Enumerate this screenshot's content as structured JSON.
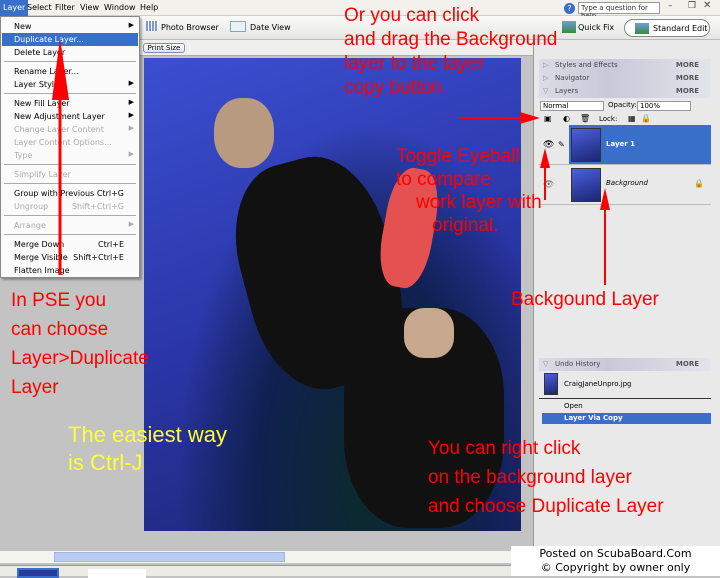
{
  "menubar": {
    "items": [
      "Layer",
      "Select",
      "Filter",
      "View",
      "Window",
      "Help"
    ],
    "help_placeholder": "Type a question for help"
  },
  "toolbar": {
    "photo_browser": "Photo Browser",
    "date_view": "Date View",
    "quick_fix": "Quick Fix",
    "standard_edit": "Standard Edit"
  },
  "options": {
    "print_size": "Print Size"
  },
  "layer_menu": [
    {
      "label": "New",
      "submenu": true
    },
    {
      "label": "Duplicate Layer...",
      "selected": true
    },
    {
      "label": "Delete Layer"
    },
    {
      "label": "Rename Layer..."
    },
    {
      "label": "Layer Style",
      "submenu": true
    },
    {
      "label": "New Fill Layer",
      "submenu": true
    },
    {
      "label": "New Adjustment Layer",
      "submenu": true
    },
    {
      "label": "Change Layer Content",
      "disabled": true,
      "submenu": true
    },
    {
      "label": "Layer Content Options...",
      "disabled": true
    },
    {
      "label": "Type",
      "disabled": true,
      "submenu": true
    },
    {
      "label": "Simplify Layer",
      "disabled": true
    },
    {
      "label": "Group with Previous",
      "shortcut": "Ctrl+G"
    },
    {
      "label": "Ungroup",
      "shortcut": "Shift+Ctrl+G",
      "disabled": true
    },
    {
      "label": "Arrange",
      "disabled": true,
      "submenu": true
    },
    {
      "label": "Merge Down",
      "shortcut": "Ctrl+E"
    },
    {
      "label": "Merge Visible",
      "shortcut": "Shift+Ctrl+E"
    },
    {
      "label": "Flatten Image"
    }
  ],
  "panels": {
    "styles": "Styles and Effects",
    "navigator": "Navigator",
    "layers": "Layers",
    "more": "MORE",
    "blend_mode": "Normal",
    "opacity_label": "Opacity:",
    "opacity": "100%",
    "lock_label": "Lock:",
    "layer1": "Layer 1",
    "background": "Background",
    "undo": "Undo History",
    "file": "CraigJaneUnpro.jpg",
    "open": "Open",
    "via_copy": "Layer Via Copy"
  },
  "annotations": {
    "drag": [
      "Or you can click",
      "and drag the Background",
      "layer to the layer",
      "copy button"
    ],
    "eyeball": [
      "Toggle Eyeball",
      "to compare",
      "work layer with",
      "original."
    ],
    "bg_layer": "Backgound Layer",
    "pse": [
      "In PSE you",
      "can choose",
      "Layer>Duplicate",
      "Layer"
    ],
    "easiest": [
      "The easiest way",
      "is Ctrl-J"
    ],
    "right_click": [
      "You can right click",
      "on the background layer",
      "and choose Duplicate Layer"
    ]
  },
  "credit": [
    "Posted on ScubaBoard.Com",
    "© Copyright by owner only"
  ],
  "colors": {
    "annotation": "#ff0000",
    "easiest": "#ffff33",
    "highlight": "#3a6fc9"
  }
}
